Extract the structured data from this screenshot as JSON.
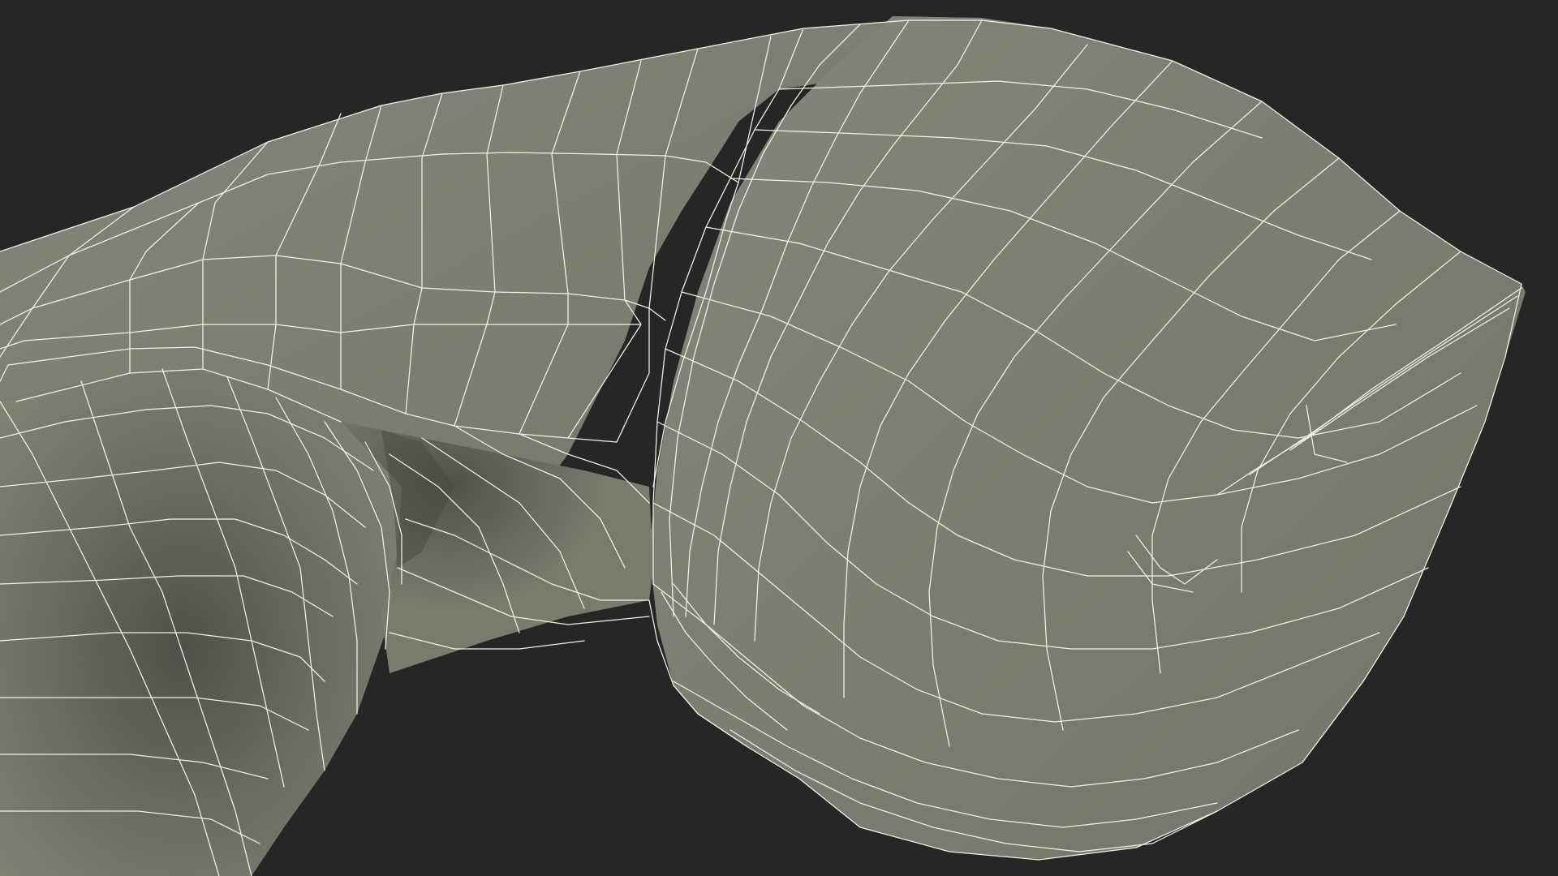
{
  "scene": {
    "background_color": "#262626",
    "surface_color": "#7b7c70",
    "surface_shadow_color": "#4e4f47",
    "wire_color": "#f3f1e6",
    "render_style": "wireframe-over-shaded"
  }
}
